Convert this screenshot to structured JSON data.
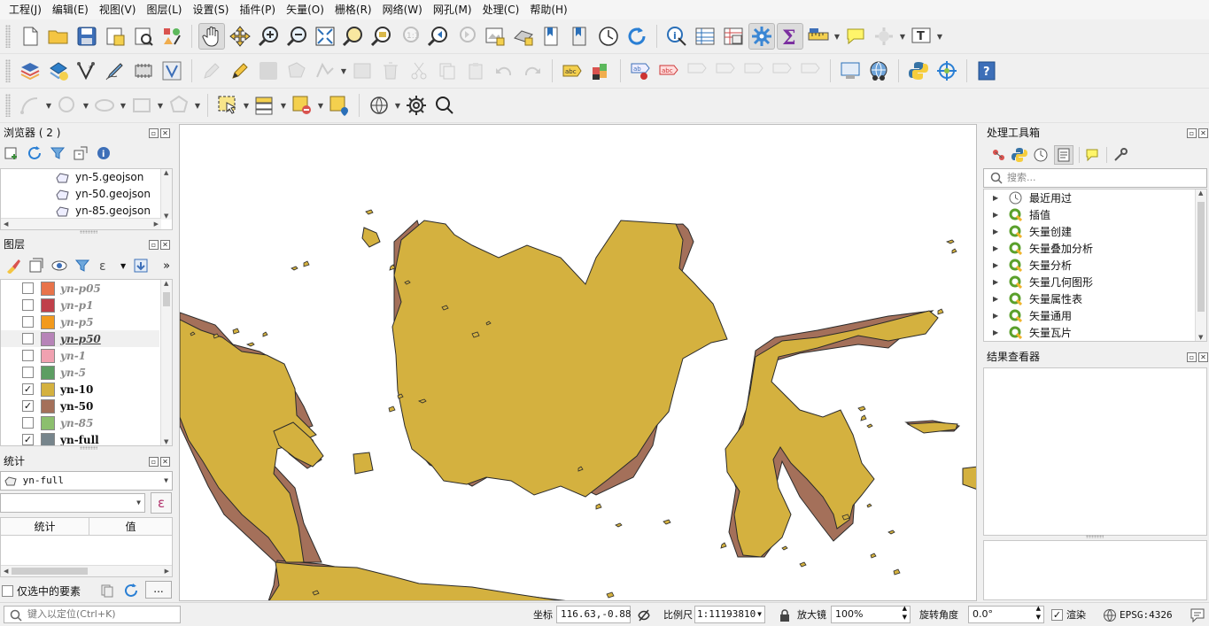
{
  "menu": [
    "工程(J)",
    "编辑(E)",
    "视图(V)",
    "图层(L)",
    "设置(S)",
    "插件(P)",
    "矢量(O)",
    "栅格(R)",
    "网络(W)",
    "网孔(M)",
    "处理(C)",
    "帮助(H)"
  ],
  "browser": {
    "title": "浏览器 ( 2 )",
    "items": [
      "yn-5.geojson",
      "yn-50.geojson",
      "yn-85.geojson"
    ]
  },
  "layers": {
    "title": "图层",
    "items": [
      {
        "name": "yn-p05",
        "checked": false,
        "color": "#e8734a"
      },
      {
        "name": "yn-p1",
        "checked": false,
        "color": "#c0404a"
      },
      {
        "name": "yn-p5",
        "checked": false,
        "color": "#f29a1d"
      },
      {
        "name": "yn-p50",
        "checked": false,
        "color": "#b784b8"
      },
      {
        "name": "yn-1",
        "checked": false,
        "color": "#f0a1b0"
      },
      {
        "name": "yn-5",
        "checked": false,
        "color": "#5d9e63"
      },
      {
        "name": "yn-10",
        "checked": true,
        "color": "#d4b13f"
      },
      {
        "name": "yn-50",
        "checked": true,
        "color": "#a4705a"
      },
      {
        "name": "yn-85",
        "checked": false,
        "color": "#8cbf6e"
      },
      {
        "name": "yn-full",
        "checked": true,
        "color": "#77858c"
      }
    ]
  },
  "stats": {
    "title": "统计",
    "layer_select": "yn-full",
    "col_stat": "统计",
    "col_value": "值",
    "selected_only": "仅选中的要素",
    "more": "..."
  },
  "processing": {
    "title": "处理工具箱",
    "search_placeholder": "搜索...",
    "items": [
      "最近用过",
      "插值",
      "矢量创建",
      "矢量叠加分析",
      "矢量分析",
      "矢量几何图形",
      "矢量属性表",
      "矢量通用",
      "矢量瓦片"
    ]
  },
  "results": {
    "title": "结果查看器"
  },
  "status": {
    "locate_placeholder": "键入以定位(Ctrl+K)",
    "coord_label": "坐标",
    "coord_value": "116.63,-0.88",
    "scale_label": "比例尺",
    "scale_value": "1:11193810",
    "magnifier_label": "放大镜",
    "magnifier_value": "100%",
    "rotation_label": "旋转角度",
    "rotation_value": "0.0°",
    "render_label": "渲染",
    "crs": "EPSG:4326"
  },
  "colors": {
    "land_main": "#d4b13f",
    "land_shadow": "#a4705a",
    "active_tool": "#dcdcdc"
  },
  "icons": {
    "toolbar1": [
      "new-project-icon",
      "open-project-icon",
      "save-project-icon",
      "save-as-icon",
      "print-layout-icon",
      "style-manager-icon",
      "pan-icon",
      "pan-to-selection-icon",
      "zoom-in-icon",
      "zoom-out-icon",
      "zoom-full-icon",
      "zoom-to-selection-icon",
      "zoom-to-layer-icon",
      "zoom-native-icon",
      "zoom-last-icon",
      "zoom-next-icon",
      "new-map-view-icon",
      "new-3d-view-icon",
      "bookmark-new-icon",
      "bookmarks-icon",
      "temporal-controller-icon",
      "refresh-icon",
      "identify-icon",
      "attribute-table-icon",
      "field-calculator-icon",
      "processing-toolbox-icon",
      "statistics-icon",
      "measure-icon",
      "map-tips-icon",
      "select-location-icon",
      "text-annotation-icon"
    ]
  }
}
